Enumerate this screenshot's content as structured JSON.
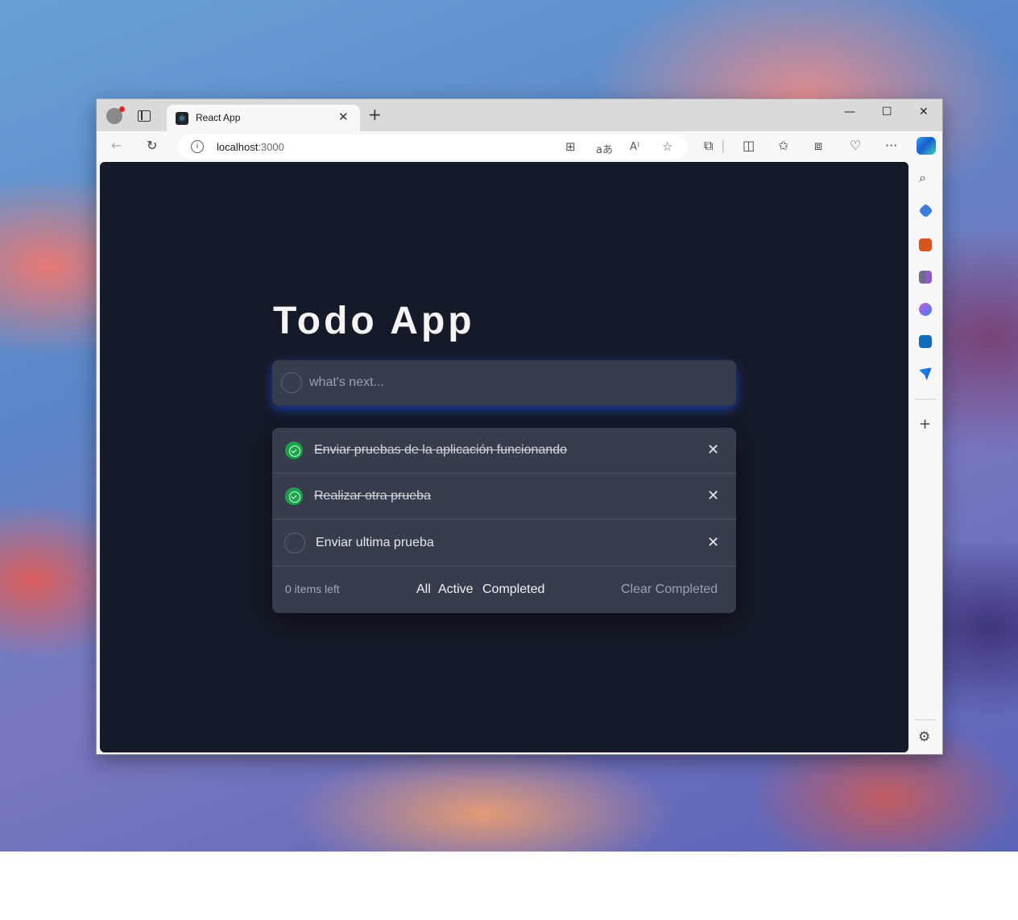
{
  "browser": {
    "tab_title": "React App",
    "tab_favicon": "react-icon",
    "address_host": "localhost",
    "address_port": ":3000",
    "window_controls": [
      "minimize-icon",
      "maximize-icon",
      "close-icon"
    ]
  },
  "app": {
    "title": "Todo App",
    "new_todo": {
      "placeholder": "what's next...",
      "value": ""
    },
    "todos": [
      {
        "text": "Enviar pruebas de la aplicación funcionando",
        "completed": true
      },
      {
        "text": "Realizar otra prueba",
        "completed": true
      },
      {
        "text": "Enviar ultima prueba",
        "completed": false
      }
    ],
    "footer": {
      "items_left": "0 items left",
      "filters": [
        "All",
        "Active",
        "Completed"
      ],
      "clear_completed": "Clear Completed"
    }
  },
  "colors": {
    "page_background": "#151a28",
    "card_background": "#383d4d",
    "completed_check": "#17a34a",
    "input_glow": "#2a5cff"
  }
}
